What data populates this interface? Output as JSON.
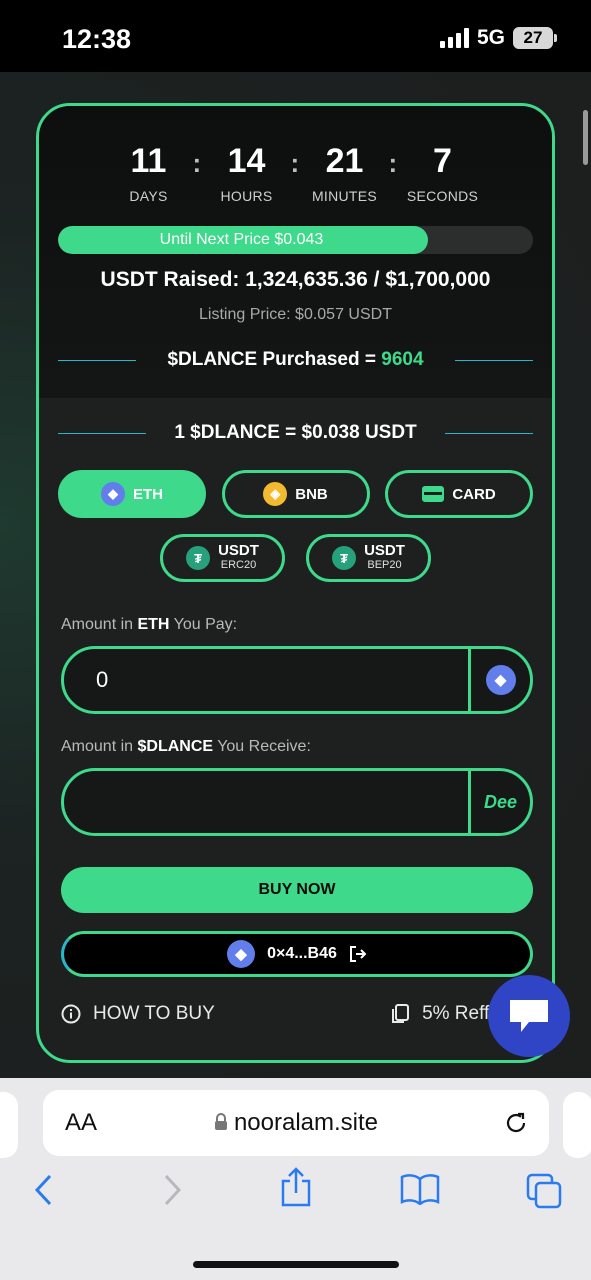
{
  "status_bar": {
    "time": "12:38",
    "network": "5G",
    "battery": "27"
  },
  "countdown": [
    {
      "value": "11",
      "label": "DAYS"
    },
    {
      "value": "14",
      "label": "HOURS"
    },
    {
      "value": "21",
      "label": "MINUTES"
    },
    {
      "value": "7",
      "label": "SECONDS"
    }
  ],
  "presale": {
    "progress_label": "Until Next Price $0.043",
    "progress_fraction": 0.778,
    "raised": "USDT Raised: 1,324,635.36 / $1,700,000",
    "listing_price": "Listing Price: $0.057 USDT",
    "purchased_label": "$DLANCE Purchased = ",
    "purchased_value": "9604",
    "rate": "1 $DLANCE = $0.038 USDT"
  },
  "payment_options": {
    "eth": "ETH",
    "bnb": "BNB",
    "card": "CARD",
    "usdt_erc20": {
      "name": "USDT",
      "network": "ERC20"
    },
    "usdt_bep20": {
      "name": "USDT",
      "network": "BEP20"
    }
  },
  "pay_field": {
    "label_pre": "Amount in ",
    "label_token": "ETH",
    "label_post": " You Pay:",
    "value": "0"
  },
  "receive_field": {
    "label_pre": "Amount in ",
    "label_token": "$DLANCE",
    "label_post": " You Receive:",
    "value": "",
    "addon": "Dee"
  },
  "buy_button": "BUY NOW",
  "wallet": {
    "address": "0×4...B46"
  },
  "links": {
    "how_to_buy": "HOW TO BUY",
    "referral": "5% Refferal"
  },
  "browser": {
    "aa": "AA",
    "url": "nooralam.site"
  },
  "colors": {
    "accent": "#3ed98a",
    "line": "#27b7c9",
    "chat": "#2f45c6"
  }
}
